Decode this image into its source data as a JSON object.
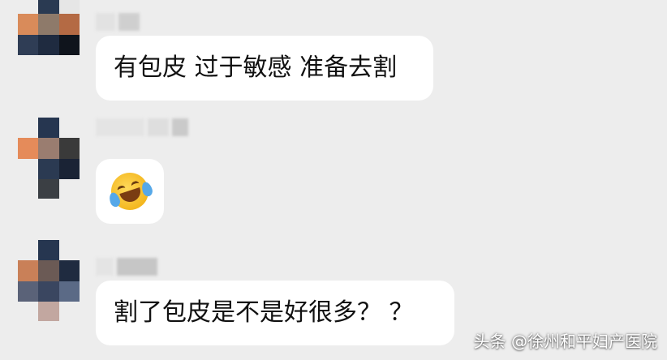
{
  "messages": [
    {
      "text": "有包皮 过于敏感 准备去割",
      "avatar": "pixelated-avatar"
    },
    {
      "emoji": "laughing-with-tears",
      "avatar": "pixelated-avatar"
    },
    {
      "text": "割了包皮是不是好很多？ ？",
      "avatar": "pixelated-avatar"
    }
  ],
  "watermark": "头条 @徐州和平妇产医院",
  "colors": {
    "background": "#ededed",
    "bubble": "#ffffff",
    "text": "#111111"
  }
}
